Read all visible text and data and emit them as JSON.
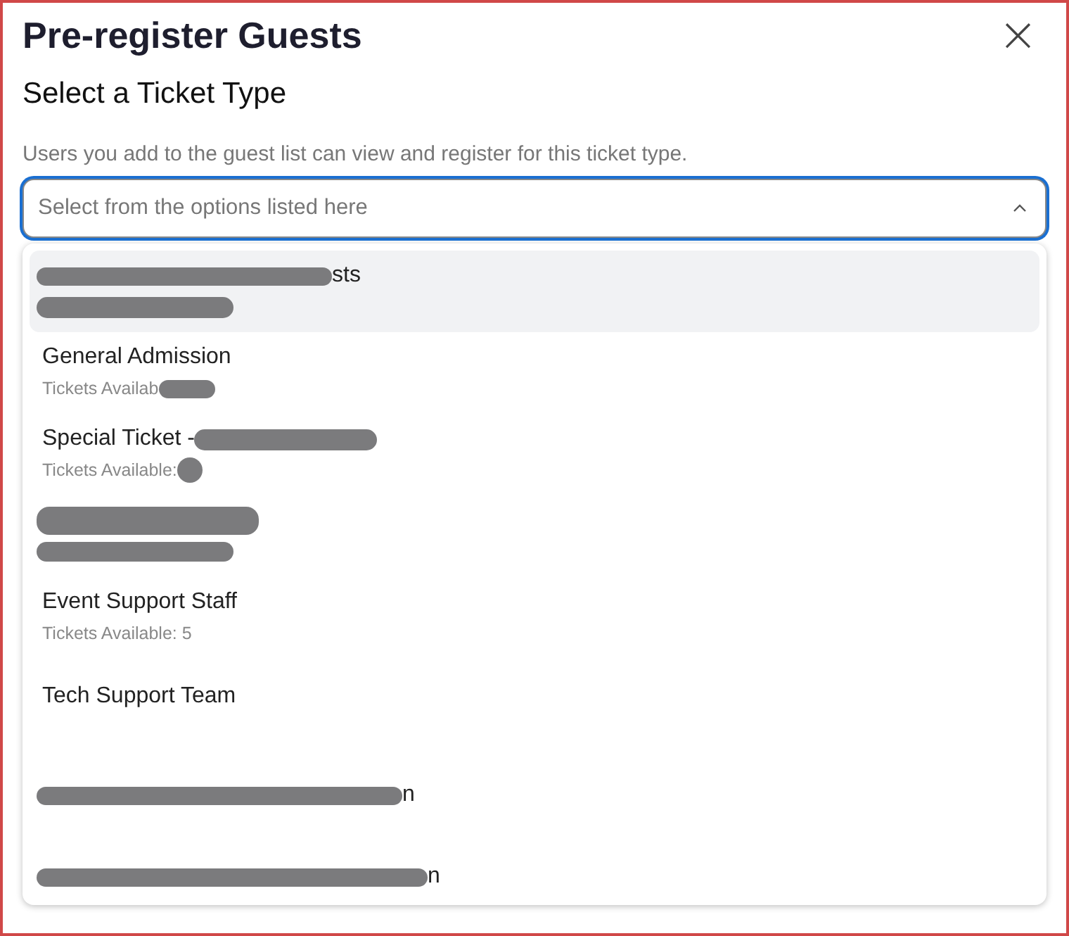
{
  "dialog": {
    "title": "Pre-register Guests",
    "subtitle": "Select a Ticket Type",
    "helper": "Users you add to the guest list can view and register for this ticket type.",
    "close": "×"
  },
  "select": {
    "placeholder": "Select from the options listed here",
    "expanded": true
  },
  "options": [
    {
      "selected": true,
      "title": [
        {
          "kind": "mark"
        },
        {
          "kind": "text",
          "text": "sts"
        }
      ],
      "detail": [
        {
          "kind": "mark"
        }
      ]
    },
    {
      "selected": false,
      "title": [
        {
          "kind": "text",
          "text": "General Admission"
        }
      ],
      "detail": [
        {
          "kind": "text",
          "text": "Tickets Availab"
        },
        {
          "kind": "mark"
        }
      ]
    },
    {
      "selected": false,
      "title": [
        {
          "kind": "text",
          "text": "Special Ticket -"
        },
        {
          "kind": "mark"
        }
      ],
      "detail": [
        {
          "kind": "text",
          "text": "Tickets Available:"
        },
        {
          "kind": "mark"
        }
      ]
    },
    {
      "selected": false,
      "title": [
        {
          "kind": "mark"
        }
      ],
      "detail": [
        {
          "kind": "mark"
        }
      ]
    },
    {
      "selected": false,
      "title": [
        {
          "kind": "text",
          "text": "Event Support Staff"
        }
      ],
      "detail": [
        {
          "kind": "text",
          "text": "Tickets Available: 5"
        }
      ]
    },
    {
      "selected": false,
      "title": [
        {
          "kind": "text",
          "text": "Tech Support Team"
        }
      ]
    },
    {
      "selected": false,
      "title": [
        {
          "kind": "mark"
        },
        {
          "kind": "text",
          "text": "n"
        }
      ]
    },
    {
      "selected": false,
      "title": [
        {
          "kind": "mark"
        },
        {
          "kind": "text",
          "text": "n"
        }
      ]
    }
  ]
}
